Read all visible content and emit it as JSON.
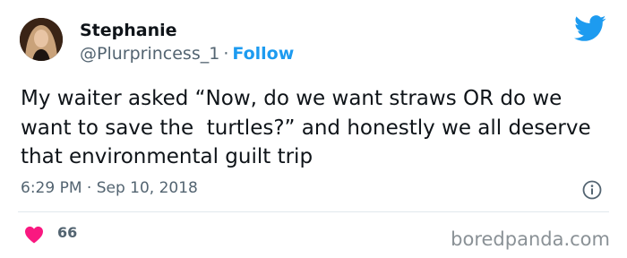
{
  "user": {
    "display_name": "Stephanie",
    "handle": "@Plurprincess_1",
    "separator": "·",
    "follow_label": "Follow"
  },
  "tweet": {
    "text": "My waiter asked “Now, do we want straws OR do we want to save the  turtles?” and honestly we all deserve that environmental guilt trip",
    "timestamp": "6:29 PM · Sep 10, 2018"
  },
  "engagement": {
    "like_count": "66"
  },
  "icons": {
    "brand": "twitter-bird-icon",
    "info": "info-icon",
    "like": "heart-icon"
  },
  "colors": {
    "brand": "#1d9bf0",
    "like": "#f91880",
    "secondary_text": "#536471"
  },
  "watermark": "boredpanda.com"
}
